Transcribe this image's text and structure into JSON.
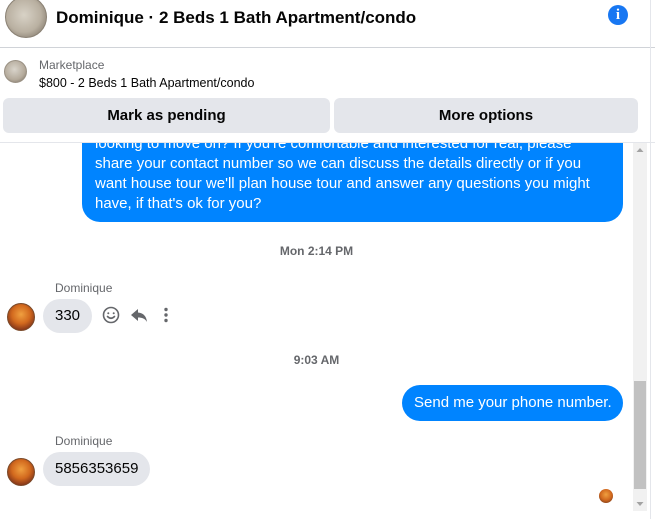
{
  "header": {
    "title": "Dominique · 2 Beds 1 Bath Apartment/condo",
    "info_icon": "info-icon"
  },
  "listing": {
    "source": "Marketplace",
    "title": "$800 - 2 Beds 1 Bath Apartment/condo",
    "mark_pending_label": "Mark as pending",
    "more_options_label": "More options"
  },
  "conversation": {
    "outgoing_long": "looking to move on? If you're comfortable and interested for real, please share your contact number so we can discuss the details directly or if you want house tour we'll plan house tour and answer any questions you might have, if that's ok for you?",
    "timestamp_1": "Mon 2:14 PM",
    "sender_1": "Dominique",
    "incoming_1": "330",
    "timestamp_2": "9:03 AM",
    "outgoing_2": "Send me your phone number.",
    "sender_2": "Dominique",
    "incoming_2": "5856353659"
  },
  "colors": {
    "accent": "#0084ff",
    "info_blue": "#1877f2",
    "incoming_bubble": "#e4e6eb",
    "secondary_text": "#65676b"
  }
}
